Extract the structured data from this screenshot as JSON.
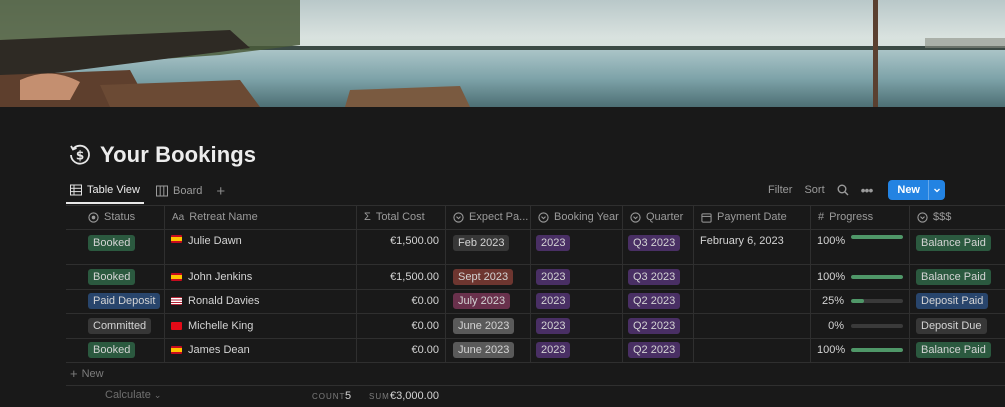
{
  "page": {
    "title": "Your Bookings"
  },
  "views": [
    {
      "label": "Table View",
      "active": true
    },
    {
      "label": "Board",
      "active": false
    }
  ],
  "toolbar": {
    "filter": "Filter",
    "sort": "Sort",
    "new": "New"
  },
  "columns": [
    "Status",
    "Retreat Name",
    "Total Cost",
    "Expect Pa...",
    "Booking Year",
    "Quarter",
    "Payment Date",
    "Progress",
    "$$$"
  ],
  "rows": [
    {
      "status": "Booked",
      "name": "Julie Dawn",
      "flag": "es",
      "total": "€1,500.00",
      "expect": "Feb 2023",
      "year": "2023",
      "quarter": "Q3 2023",
      "payment_date": "February 6, 2023",
      "progress_label": "100%",
      "progress": 1.0,
      "money": "Balance Paid"
    },
    {
      "status": "Booked",
      "name": "John Jenkins",
      "flag": "es",
      "total": "€1,500.00",
      "expect": "Sept 2023",
      "year": "2023",
      "quarter": "Q3 2023",
      "payment_date": "",
      "progress_label": "100%",
      "progress": 1.0,
      "money": "Balance Paid"
    },
    {
      "status": "Paid Deposit",
      "name": "Ronald Davies",
      "flag": "us",
      "total": "€0.00",
      "expect": "July 2023",
      "year": "2023",
      "quarter": "Q2 2023",
      "payment_date": "",
      "progress_label": "25%",
      "progress": 0.25,
      "money": "Deposit Paid"
    },
    {
      "status": "Committed",
      "name": "Michelle King",
      "flag": "tr",
      "total": "€0.00",
      "expect": "June 2023",
      "year": "2023",
      "quarter": "Q2 2023",
      "payment_date": "",
      "progress_label": "0%",
      "progress": 0.0,
      "money": "Deposit Due"
    },
    {
      "status": "Booked",
      "name": "James Dean",
      "flag": "es",
      "total": "€0.00",
      "expect": "June 2023",
      "year": "2023",
      "quarter": "Q2 2023",
      "payment_date": "",
      "progress_label": "100%",
      "progress": 1.0,
      "money": "Balance Paid"
    }
  ],
  "footer": {
    "new": "New",
    "calculate": "Calculate",
    "count_label": "COUNT",
    "count_value": "5",
    "sum_label": "SUM",
    "sum_value": "€3,000.00"
  },
  "colors": {
    "booked": "#2b593f",
    "paid_deposit": "#28456c",
    "committed": "#373737",
    "feb": "#373737",
    "sept": "#6e3630",
    "july": "#69314c",
    "june": "#5a5a5a",
    "year": "#492f64",
    "quarter": "#492f64",
    "balance_paid": "#2b593f",
    "deposit_paid": "#28456c",
    "deposit_due": "#373737",
    "accent": "#2383e2"
  }
}
